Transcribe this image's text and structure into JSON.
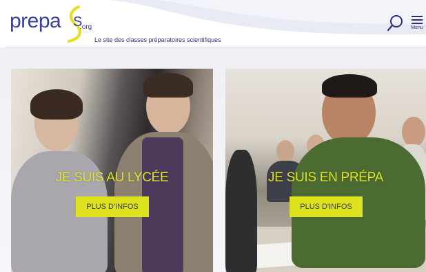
{
  "header": {
    "logo_text": "prepa",
    "logo_s": "S",
    "logo_org": ".org",
    "tagline": "Le site des classes préparatoires scientifiques",
    "search_icon": "search-icon",
    "menu_icon": "hamburger-menu-icon",
    "menu_label": "Menu"
  },
  "colors": {
    "brand_blue": "#3b3f9a",
    "accent_yellow": "#dfe21f"
  },
  "cards": [
    {
      "title": "JE SUIS AU LYCÉE",
      "button_label": "PLUS D'INFOS"
    },
    {
      "title": "JE SUIS EN PRÉPA",
      "button_label": "PLUS D'INFOS"
    }
  ]
}
